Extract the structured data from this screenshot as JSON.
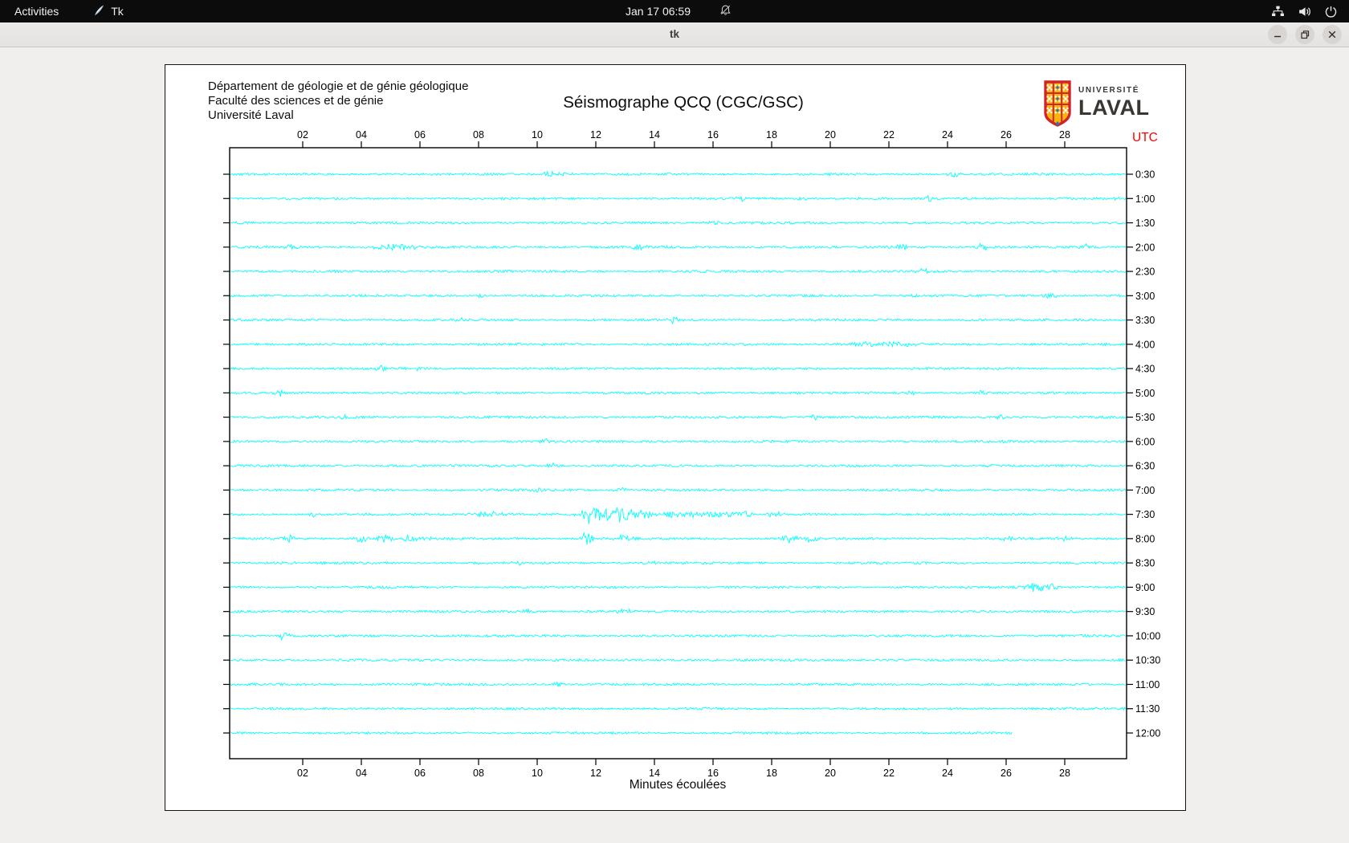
{
  "topbar": {
    "activities": "Activities",
    "app_name": "Tk",
    "clock": "Jan 17  06:59"
  },
  "titlebar": {
    "title": "tk"
  },
  "canvas": {
    "header_lines": [
      "Département de géologie et de génie géologique",
      "Faculté des sciences et de génie",
      "Université Laval"
    ],
    "title": "Séismographe QCQ (CGC/GSC)",
    "logo": {
      "line1": "UNIVERSITÉ",
      "line2": "LAVAL"
    },
    "utc_label": "UTC",
    "xlabel": "Minutes écoulées"
  },
  "chart_data": {
    "type": "line",
    "description": "24 half-hour seismogram traces, station QCQ (CGC/GSC), times UTC",
    "x_ticks": [
      "02",
      "04",
      "06",
      "08",
      "10",
      "12",
      "14",
      "16",
      "18",
      "20",
      "22",
      "24",
      "26",
      "28"
    ],
    "x_tick_minutes": [
      2,
      4,
      6,
      8,
      10,
      12,
      14,
      16,
      18,
      20,
      22,
      24,
      26,
      28
    ],
    "x_range_minutes": [
      0,
      30
    ],
    "right_labels": [
      "0:30",
      "1:00",
      "1:30",
      "2:00",
      "2:30",
      "3:00",
      "3:30",
      "4:00",
      "4:30",
      "5:00",
      "5:30",
      "6:00",
      "6:30",
      "7:00",
      "7:30",
      "8:00",
      "8:30",
      "9:00",
      "9:30",
      "10:00",
      "10:30",
      "11:00",
      "11:30",
      "12:00"
    ],
    "rows": 24,
    "last_row_end_minute": 26.2,
    "trace_color": "#00ffff",
    "events": [
      [
        0,
        10.4,
        4,
        0.15
      ],
      [
        0,
        11.0,
        2.5,
        0.2
      ],
      [
        0,
        24.2,
        3.5,
        0.15
      ],
      [
        1,
        17.0,
        3.5,
        0.15
      ],
      [
        1,
        19.0,
        2.5,
        0.15
      ],
      [
        1,
        23.4,
        4,
        0.12
      ],
      [
        1,
        29.7,
        3,
        0.12
      ],
      [
        2,
        16.1,
        3.5,
        0.15
      ],
      [
        3,
        1.7,
        4.5,
        0.15
      ],
      [
        3,
        5.1,
        5,
        0.5
      ],
      [
        3,
        13.4,
        3.5,
        0.2
      ],
      [
        3,
        22.4,
        3.5,
        0.2
      ],
      [
        3,
        25.2,
        4.5,
        0.15
      ],
      [
        3,
        28.7,
        3.5,
        0.15
      ],
      [
        4,
        23.2,
        3.5,
        0.15
      ],
      [
        5,
        8.1,
        2.5,
        0.15
      ],
      [
        5,
        22.9,
        2.5,
        0.15
      ],
      [
        5,
        27.5,
        3.5,
        0.2
      ],
      [
        6,
        7.5,
        2.5,
        0.15
      ],
      [
        6,
        14.7,
        4.5,
        0.15
      ],
      [
        7,
        21.7,
        3,
        0.8
      ],
      [
        8,
        4.7,
        3.5,
        0.2
      ],
      [
        8,
        6.0,
        2.5,
        0.15
      ],
      [
        9,
        1.2,
        3.5,
        0.12
      ],
      [
        9,
        22.8,
        2.5,
        0.15
      ],
      [
        9,
        25.1,
        2.5,
        0.15
      ],
      [
        10,
        3.5,
        3.5,
        0.15
      ],
      [
        10,
        19.5,
        3.5,
        0.15
      ],
      [
        10,
        25.8,
        2.5,
        0.15
      ],
      [
        11,
        10.3,
        2,
        0.15
      ],
      [
        11,
        26.0,
        2,
        0.15
      ],
      [
        12,
        10.5,
        5.5,
        0.12
      ],
      [
        12,
        25.4,
        3.5,
        0.15
      ],
      [
        13,
        10.1,
        3.5,
        0.15
      ],
      [
        13,
        13.0,
        2.5,
        0.3
      ],
      [
        14,
        2.4,
        4.5,
        0.12
      ],
      [
        14,
        8.4,
        3.5,
        0.4
      ],
      [
        14,
        11.85,
        13,
        0.18
      ],
      [
        14,
        12.4,
        6,
        0.6
      ],
      [
        14,
        12.9,
        9,
        0.25
      ],
      [
        14,
        13.6,
        5,
        0.3
      ],
      [
        14,
        14.6,
        4.5,
        0.25
      ],
      [
        14,
        15.4,
        4.5,
        0.3
      ],
      [
        14,
        16.2,
        4,
        0.3
      ],
      [
        14,
        17.0,
        4,
        0.3
      ],
      [
        14,
        18.1,
        3.5,
        0.25
      ],
      [
        15,
        1.5,
        6.5,
        0.12
      ],
      [
        15,
        4.0,
        4.5,
        0.2
      ],
      [
        15,
        4.8,
        4.5,
        0.25
      ],
      [
        15,
        5.5,
        4,
        0.25
      ],
      [
        15,
        6.2,
        3.5,
        0.2
      ],
      [
        15,
        11.7,
        8.5,
        0.15
      ],
      [
        15,
        13.0,
        5.5,
        0.2
      ],
      [
        15,
        18.6,
        4.5,
        0.2
      ],
      [
        15,
        19.4,
        4.5,
        0.2
      ],
      [
        15,
        26.1,
        4.5,
        0.15
      ],
      [
        15,
        28.0,
        2.5,
        0.15
      ],
      [
        16,
        9.3,
        2.5,
        0.15
      ],
      [
        16,
        14.0,
        2.5,
        0.2
      ],
      [
        17,
        27.0,
        6,
        0.25
      ],
      [
        17,
        27.6,
        4,
        0.2
      ],
      [
        18,
        9.7,
        3,
        0.15
      ],
      [
        18,
        13.0,
        3,
        0.2
      ],
      [
        19,
        1.35,
        5.5,
        0.12
      ],
      [
        21,
        10.7,
        3,
        0.15
      ]
    ]
  },
  "colors": {
    "trace": "#00ffff",
    "utc_red": "#ff0000",
    "topbar_bg": "#0c0c0c",
    "logo_red": "#d2232a",
    "logo_gold": "#f7b508",
    "logo_blue": "#2276bc"
  }
}
